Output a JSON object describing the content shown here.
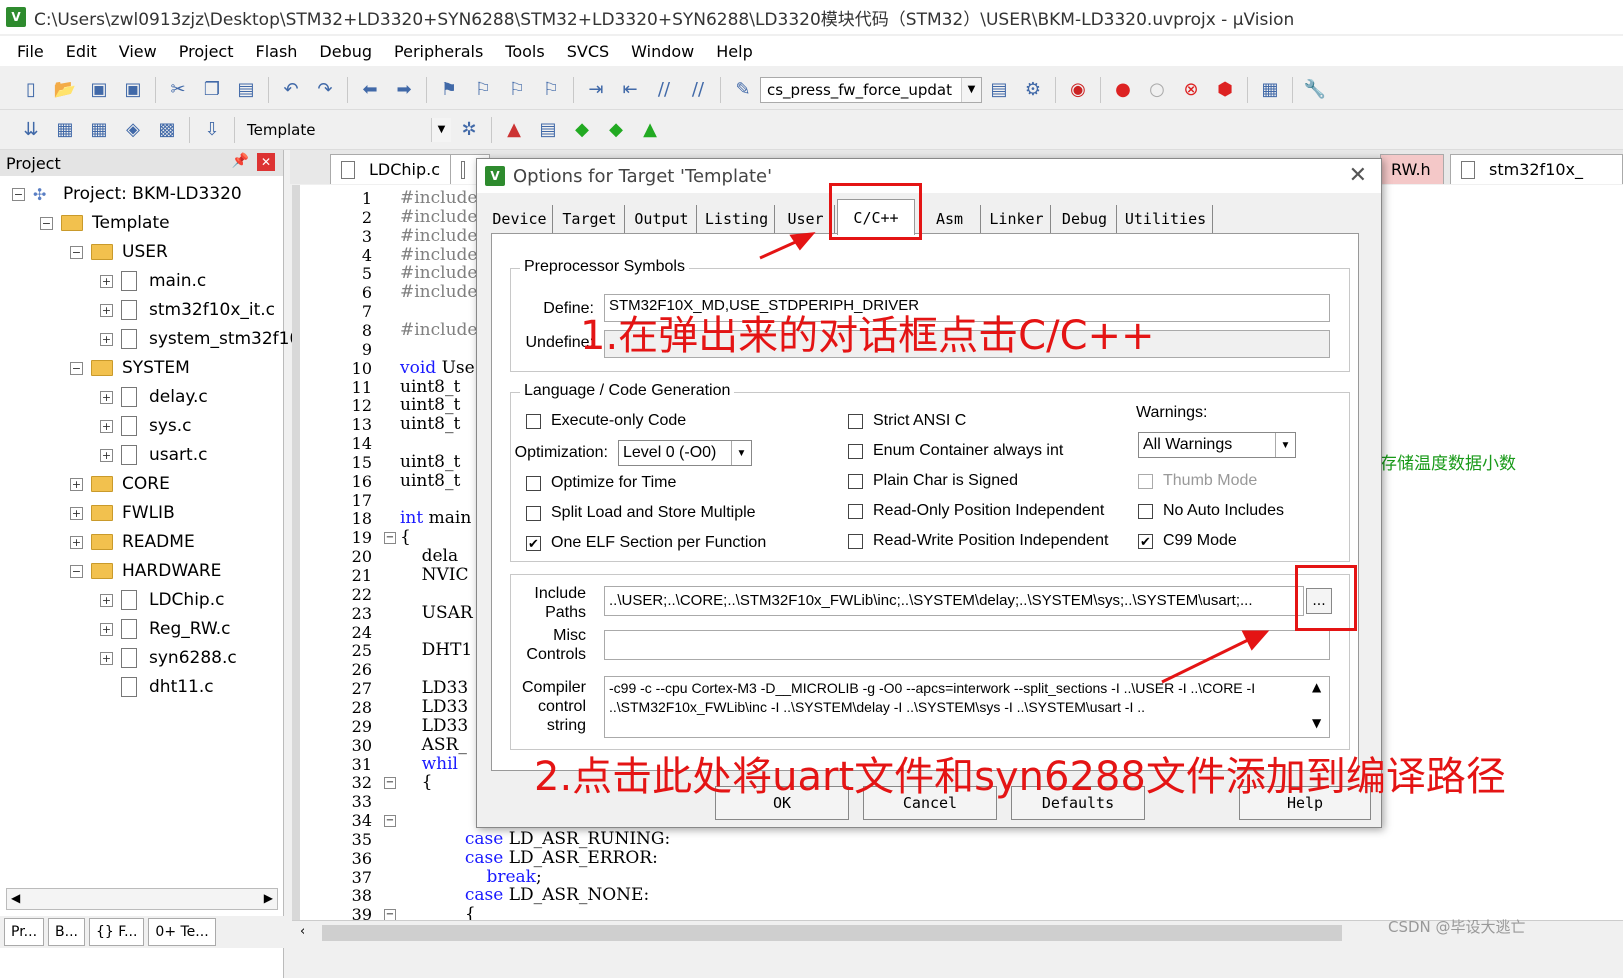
{
  "window": {
    "title": "C:\\Users\\zwl0913zjz\\Desktop\\STM32+LD3320+SYN6288\\STM32+LD3320+SYN6288\\LD3320模块代码（STM32）\\USER\\BKM-LD3320.uvprojx - µVision",
    "icon": "uvision-icon"
  },
  "menu": [
    "File",
    "Edit",
    "View",
    "Project",
    "Flash",
    "Debug",
    "Peripherals",
    "Tools",
    "SVCS",
    "Window",
    "Help"
  ],
  "toolbar1": {
    "find_combo": "cs_press_fw_force_updat"
  },
  "toolbar2": {
    "target_combo": "Template"
  },
  "project_panel": {
    "title": "Project",
    "tree": [
      {
        "label": "Project: BKM-LD3320",
        "kind": "project",
        "level": 0,
        "exp": "−"
      },
      {
        "label": "Template",
        "kind": "target",
        "level": 1,
        "exp": "−"
      },
      {
        "label": "USER",
        "kind": "folder",
        "level": 2,
        "exp": "−"
      },
      {
        "label": "main.c",
        "kind": "file",
        "level": 3,
        "exp": "+"
      },
      {
        "label": "stm32f10x_it.c",
        "kind": "file",
        "level": 3,
        "exp": "+"
      },
      {
        "label": "system_stm32f10",
        "kind": "file",
        "level": 3,
        "exp": "+"
      },
      {
        "label": "SYSTEM",
        "kind": "folder",
        "level": 2,
        "exp": "−"
      },
      {
        "label": "delay.c",
        "kind": "file",
        "level": 3,
        "exp": "+"
      },
      {
        "label": "sys.c",
        "kind": "file",
        "level": 3,
        "exp": "+"
      },
      {
        "label": "usart.c",
        "kind": "file",
        "level": 3,
        "exp": "+"
      },
      {
        "label": "CORE",
        "kind": "folder",
        "level": 2,
        "exp": "+"
      },
      {
        "label": "FWLIB",
        "kind": "folder",
        "level": 2,
        "exp": "+"
      },
      {
        "label": "README",
        "kind": "folder",
        "level": 2,
        "exp": "+"
      },
      {
        "label": "HARDWARE",
        "kind": "folder",
        "level": 2,
        "exp": "−"
      },
      {
        "label": "LDChip.c",
        "kind": "file",
        "level": 3,
        "exp": "+"
      },
      {
        "label": "Reg_RW.c",
        "kind": "file",
        "level": 3,
        "exp": "+"
      },
      {
        "label": "syn6288.c",
        "kind": "file",
        "level": 3,
        "exp": "+"
      },
      {
        "label": "dht11.c",
        "kind": "file",
        "level": 3,
        "exp": ""
      }
    ],
    "bottom_tabs": [
      "Pr...",
      "B...",
      "{} F...",
      "0+ Te..."
    ]
  },
  "editor_tabs": [
    {
      "label": "LDChip.c"
    },
    {
      "label": ""
    },
    {
      "label": "RW.h"
    },
    {
      "label": "stm32f10x_"
    }
  ],
  "code": {
    "line_numbers": [
      "1",
      "2",
      "3",
      "4",
      "5",
      "6",
      "7",
      "8",
      "9",
      "10",
      "11",
      "12",
      "13",
      "14",
      "15",
      "16",
      "17",
      "18",
      "19",
      "20",
      "21",
      "22",
      "23",
      "24",
      "25",
      "26",
      "27",
      "28",
      "29",
      "30",
      "31",
      "32",
      "33",
      "34",
      "35",
      "36",
      "37",
      "38",
      "39"
    ],
    "lines": [
      {
        "n": 1,
        "parts": [
          {
            "t": "#include",
            "c": "pp"
          }
        ]
      },
      {
        "n": 2,
        "parts": [
          {
            "t": "#include",
            "c": "pp"
          }
        ]
      },
      {
        "n": 3,
        "parts": [
          {
            "t": "#include",
            "c": "pp"
          }
        ]
      },
      {
        "n": 4,
        "parts": [
          {
            "t": "#include",
            "c": "pp"
          }
        ]
      },
      {
        "n": 5,
        "parts": [
          {
            "t": "#include",
            "c": "pp"
          }
        ]
      },
      {
        "n": 6,
        "parts": [
          {
            "t": "#include",
            "c": "pp"
          }
        ]
      },
      {
        "n": 8,
        "parts": [
          {
            "t": "#include",
            "c": "pp"
          }
        ]
      },
      {
        "n": 10,
        "parts": [
          {
            "t": "void ",
            "c": "kw"
          },
          {
            "t": "Use",
            "c": ""
          }
        ]
      },
      {
        "n": 11,
        "parts": [
          {
            "t": "uint8_t",
            "c": ""
          }
        ]
      },
      {
        "n": 12,
        "parts": [
          {
            "t": "uint8_t",
            "c": ""
          }
        ]
      },
      {
        "n": 13,
        "parts": [
          {
            "t": "uint8_t",
            "c": ""
          }
        ]
      },
      {
        "n": 15,
        "parts": [
          {
            "t": "uint8_t",
            "c": ""
          }
        ]
      },
      {
        "n": 16,
        "parts": [
          {
            "t": "uint8_t",
            "c": ""
          }
        ]
      },
      {
        "n": 18,
        "parts": [
          {
            "t": "int ",
            "c": "kw"
          },
          {
            "t": "main",
            "c": ""
          }
        ]
      },
      {
        "n": 19,
        "parts": [
          {
            "t": "{",
            "c": ""
          }
        ]
      },
      {
        "n": 20,
        "parts": [
          {
            "t": "    dela",
            "c": ""
          }
        ]
      },
      {
        "n": 21,
        "parts": [
          {
            "t": "    NVIC",
            "c": ""
          }
        ]
      },
      {
        "n": 23,
        "parts": [
          {
            "t": "    USAR",
            "c": ""
          }
        ]
      },
      {
        "n": 25,
        "parts": [
          {
            "t": "    DHT1",
            "c": ""
          }
        ]
      },
      {
        "n": 27,
        "parts": [
          {
            "t": "    LD33",
            "c": ""
          }
        ]
      },
      {
        "n": 28,
        "parts": [
          {
            "t": "    LD33",
            "c": ""
          }
        ]
      },
      {
        "n": 29,
        "parts": [
          {
            "t": "    LD33",
            "c": ""
          }
        ]
      },
      {
        "n": 30,
        "parts": [
          {
            "t": "    ASR_",
            "c": ""
          }
        ]
      },
      {
        "n": 31,
        "parts": [
          {
            "t": "    whil",
            "c": "kw"
          }
        ]
      },
      {
        "n": 32,
        "parts": [
          {
            "t": "    {",
            "c": ""
          }
        ]
      },
      {
        "n": 35,
        "parts": [
          {
            "t": "            case ",
            "c": "kw"
          },
          {
            "t": "LD_ASR_RUNING:",
            "c": ""
          }
        ]
      },
      {
        "n": 36,
        "parts": [
          {
            "t": "            case ",
            "c": "kw"
          },
          {
            "t": "LD_ASR_ERROR:",
            "c": ""
          }
        ]
      },
      {
        "n": 37,
        "parts": [
          {
            "t": "                break",
            "c": "kw"
          },
          {
            "t": ";",
            "c": ""
          }
        ]
      },
      {
        "n": 38,
        "parts": [
          {
            "t": "            case ",
            "c": "kw"
          },
          {
            "t": "LD_ASR_NONE:",
            "c": ""
          }
        ]
      },
      {
        "n": 39,
        "parts": [
          {
            "t": "            {",
            "c": ""
          }
        ]
      }
    ],
    "comment_fragment": "存储温度数据小数"
  },
  "dialog": {
    "title": "Options for Target 'Template'",
    "tabs": [
      "Device",
      "Target",
      "Output",
      "Listing",
      "User",
      "C/C++",
      "Asm",
      "Linker",
      "Debug",
      "Utilities"
    ],
    "active_tab": "C/C++",
    "preprocessor": {
      "group_label": "Preprocessor Symbols",
      "define_label": "Define:",
      "define_value": "STM32F10X_MD,USE_STDPERIPH_DRIVER",
      "undefine_label": "Undefine:",
      "undefine_value": ""
    },
    "language": {
      "group_label": "Language / Code Generation",
      "execute_only": {
        "label": "Execute-only Code",
        "checked": false
      },
      "optimization_label": "Optimization:",
      "optimization_value": "Level 0 (-O0)",
      "optimize_time": {
        "label": "Optimize for Time",
        "checked": false
      },
      "split_load": {
        "label": "Split Load and Store Multiple",
        "checked": false
      },
      "one_elf": {
        "label": "One ELF Section per Function",
        "checked": true
      },
      "strict_ansi": {
        "label": "Strict ANSI C",
        "checked": false
      },
      "enum_container": {
        "label": "Enum Container always int",
        "checked": false
      },
      "plain_char": {
        "label": "Plain Char is Signed",
        "checked": false
      },
      "ro_pi": {
        "label": "Read-Only Position Independent",
        "checked": false
      },
      "rw_pi": {
        "label": "Read-Write Position Independent",
        "checked": false
      },
      "warnings_label": "Warnings:",
      "warnings_value": "All Warnings",
      "thumb_mode": {
        "label": "Thumb Mode",
        "checked": false
      },
      "no_auto_includes": {
        "label": "No Auto Includes",
        "checked": false
      },
      "c99_mode": {
        "label": "C99 Mode",
        "checked": true
      }
    },
    "include_paths_label": "Include\nPaths",
    "include_paths_value": "..\\USER;..\\CORE;..\\STM32F10x_FWLib\\inc;..\\SYSTEM\\delay;..\\SYSTEM\\sys;..\\SYSTEM\\usart;...",
    "misc_controls_label": "Misc\nControls",
    "misc_controls_value": "",
    "compiler_string_label": "Compiler\ncontrol\nstring",
    "compiler_string_value": "-c99 -c --cpu Cortex-M3 -D__MICROLIB -g -O0 --apcs=interwork --split_sections -I ..\\USER -I ..\\CORE -I ..\\STM32F10x_FWLib\\inc -I ..\\SYSTEM\\delay -I ..\\SYSTEM\\sys -I ..\\SYSTEM\\usart -I ..",
    "browse_label": "...",
    "buttons": {
      "ok": "OK",
      "cancel": "Cancel",
      "defaults": "Defaults",
      "help": "Help"
    }
  },
  "annotations": {
    "step1": "1.在弹出来的对话框点击C/C++",
    "step2": "2.点击此处将uart文件和syn6288文件添加到编译路径",
    "color": "#e41414"
  },
  "watermark": "CSDN @毕设大逃亡"
}
